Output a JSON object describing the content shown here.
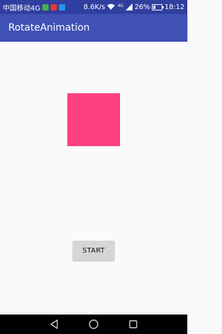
{
  "status_bar": {
    "carrier": "中国移动4G",
    "network_speed": "8.6K/s",
    "network_type": "4G",
    "battery_percent": "26%",
    "battery_level": 0.26,
    "time": "18:12",
    "notification_icons": [
      {
        "name": "green-app-notification-icon",
        "color": "#4caf50"
      },
      {
        "name": "red-app-notification-icon",
        "color": "#e53935"
      },
      {
        "name": "blue-app-notification-icon",
        "color": "#2196f3"
      }
    ]
  },
  "app_bar": {
    "title": "RotateAnimation"
  },
  "main": {
    "start_button_label": "START"
  },
  "nav_bar": {
    "buttons": [
      "back-icon",
      "home-icon",
      "recents-icon"
    ]
  },
  "colors": {
    "status_bar": "#303f9f",
    "primary": "#3f51b5",
    "accent": "#ff4081",
    "background": "#fafafa"
  }
}
